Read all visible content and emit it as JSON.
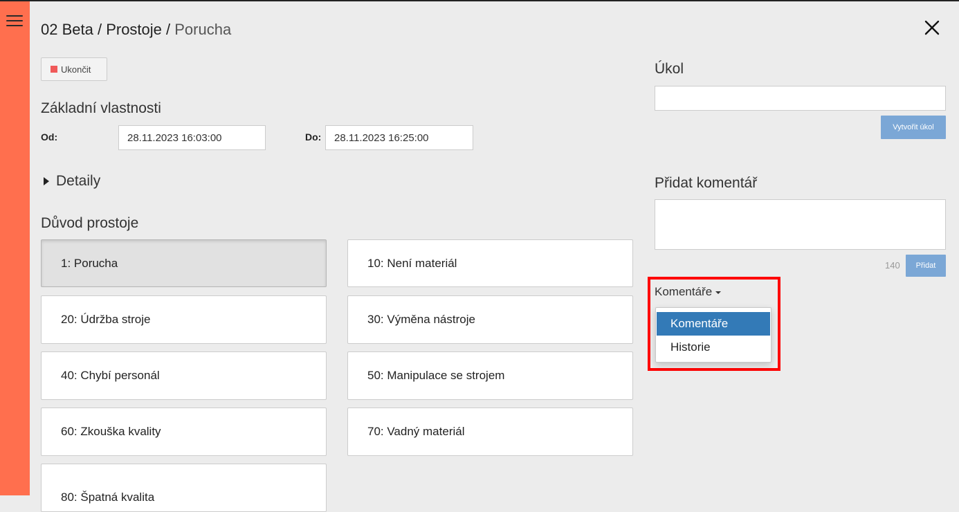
{
  "breadcrumb": {
    "line": "02 Beta",
    "section": "Prostoje",
    "current": "Porucha",
    "separator": " / "
  },
  "actions": {
    "stop_label": "Ukončit",
    "stop_color": "#f05a5a"
  },
  "properties": {
    "heading": "Základní vlastnosti",
    "from_label": "Od:",
    "from_value": "28.11.2023 16:03:00",
    "to_label": "Do:",
    "to_value": "28.11.2023 16:25:00"
  },
  "details": {
    "label": "Detaily"
  },
  "reasons": {
    "heading": "Důvod prostoje",
    "items": [
      {
        "label": "1: Porucha",
        "selected": true
      },
      {
        "label": "10: Není materiál",
        "selected": false
      },
      {
        "label": "20: Údržba stroje",
        "selected": false
      },
      {
        "label": "30: Výměna nástroje",
        "selected": false
      },
      {
        "label": "40: Chybí personál",
        "selected": false
      },
      {
        "label": "50: Manipulace se strojem",
        "selected": false
      },
      {
        "label": "60: Zkouška kvality",
        "selected": false
      },
      {
        "label": "70: Vadný materiál",
        "selected": false
      },
      {
        "label": "80: Špatná kvalita",
        "selected": false
      }
    ]
  },
  "task": {
    "heading": "Úkol",
    "value": "",
    "create_label": "Vytvořit úkol"
  },
  "comment": {
    "heading": "Přidat komentář",
    "value": "",
    "remaining": "140",
    "add_label": "Přidat"
  },
  "comments_dropdown": {
    "label": "Komentáře",
    "options": [
      "Komentáře",
      "Historie"
    ],
    "selected": "Komentáře",
    "highlight_color": "#ff0000"
  },
  "colors": {
    "sidebar": "#ff6f4e",
    "accent": "#337ab7",
    "button_blue": "#7ba7d6"
  },
  "icons": {
    "menu": "hamburger-icon",
    "close": "close-icon",
    "stop": "stop-square-icon",
    "expand": "caret-right-icon",
    "dropdown": "caret-down-icon"
  }
}
